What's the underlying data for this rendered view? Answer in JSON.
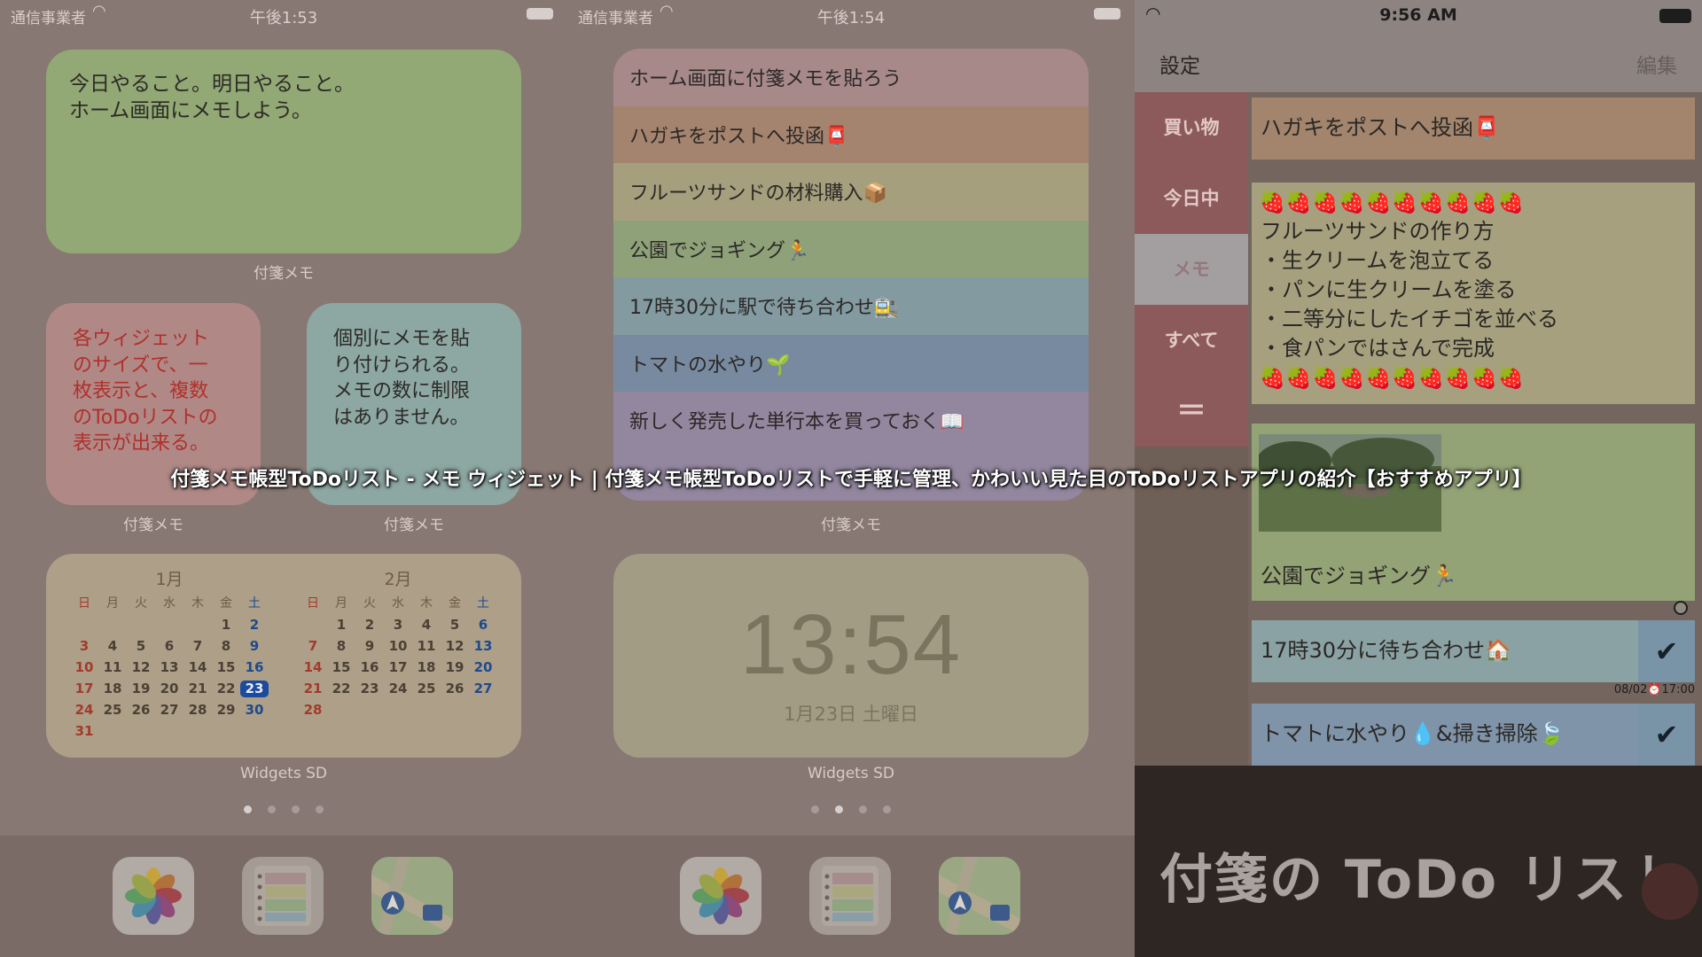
{
  "panel1": {
    "status": {
      "carrier": "通信事業者",
      "time": "午後1:53"
    },
    "memo_big": {
      "text": "今日やること。明日やること。\nホーム画面にメモしよう。",
      "label": "付箋メモ",
      "color": "#92a875"
    },
    "memo_pink": {
      "text": "各ウィジェット\nのサイズで、一\n枚表示と、複数\nのToDoリストの\n表示が出来る。",
      "label": "付箋メモ",
      "color": "#b08987",
      "text_color": "#b0302b"
    },
    "memo_blue": {
      "text": "個別にメモを貼\nり付けられる。\nメモの数に制限\nはありません。",
      "label": "付箋メモ",
      "color": "#8da7a2"
    },
    "calendar": {
      "label": "Widgets SD",
      "weekdays": [
        "日",
        "月",
        "火",
        "水",
        "木",
        "金",
        "土"
      ],
      "months": [
        {
          "title": "1月",
          "days": [
            "",
            "",
            "",
            "",
            "",
            "1",
            "2",
            "3",
            "4",
            "5",
            "6",
            "7",
            "8",
            "9",
            "10",
            "11",
            "12",
            "13",
            "14",
            "15",
            "16",
            "17",
            "18",
            "19",
            "20",
            "21",
            "22",
            "23",
            "24",
            "25",
            "26",
            "27",
            "28",
            "29",
            "30",
            "31"
          ],
          "today": "23"
        },
        {
          "title": "2月",
          "days": [
            "",
            "1",
            "2",
            "3",
            "4",
            "5",
            "6",
            "7",
            "8",
            "9",
            "10",
            "11",
            "12",
            "13",
            "14",
            "15",
            "16",
            "17",
            "18",
            "19",
            "20",
            "21",
            "22",
            "23",
            "24",
            "25",
            "26",
            "27",
            "28"
          ]
        }
      ]
    },
    "page_dots": 4,
    "active_dot": 0
  },
  "panel2": {
    "status": {
      "carrier": "通信事業者",
      "time": "午後1:54"
    },
    "list": {
      "label": "付箋メモ",
      "items": [
        {
          "text": "ホーム画面に付箋メモを貼ろう",
          "color": "#a8898a"
        },
        {
          "text": "ハガキをポストへ投函📮",
          "color": "#a5846f"
        },
        {
          "text": "フルーツサンドの材料購入📦",
          "color": "#a69f7d"
        },
        {
          "text": "公園でジョギング🏃",
          "color": "#8fa178"
        },
        {
          "text": "17時30分に駅で待ち合わせ🚉",
          "color": "#829aa0"
        },
        {
          "text": "トマトの水やり🌱",
          "color": "#778aa0"
        },
        {
          "text": "新しく発売した単行本を買っておく📖",
          "color": "#93869f"
        }
      ]
    },
    "clock": {
      "time": "13:54",
      "date": "1月23日 土曜日",
      "label": "Widgets SD"
    },
    "page_dots": 4,
    "active_dot": 1
  },
  "panel3": {
    "status": {
      "time": "9:56 AM"
    },
    "nav": {
      "settings": "設定",
      "edit": "編集"
    },
    "tabs": [
      "買い物",
      "今日中",
      "メモ",
      "すべて"
    ],
    "menu_glyph": "＝",
    "active_tab": 2,
    "notes": {
      "postcard": "ハガキをポストへ投函📮",
      "recipe_strawberries": "🍓🍓🍓🍓🍓🍓🍓🍓🍓🍓",
      "recipe_text": "フルーツサンドの作り方\n・生クリームを泡立てる\n・パンに生クリームを塗る\n・二等分にしたイチゴを並べる\n・食パンではさんで完成",
      "jogging": "公園でジョギング🏃",
      "meeting": "17時30分に待ち合わせ🏠",
      "meeting_due": "08/02⏰17:00",
      "tomato": "トマトに水やり💧&掃き掃除🍃",
      "check": "✔"
    },
    "footer_title": "付箋の ToDo リスト"
  },
  "caption": "付箋メモ帳型ToDoリスト - メモ ウィジェット | 付箋メモ帳型ToDoリストで手軽に管理、かわいい見た目のToDoリストアプリの紹介【おすすめアプリ】"
}
